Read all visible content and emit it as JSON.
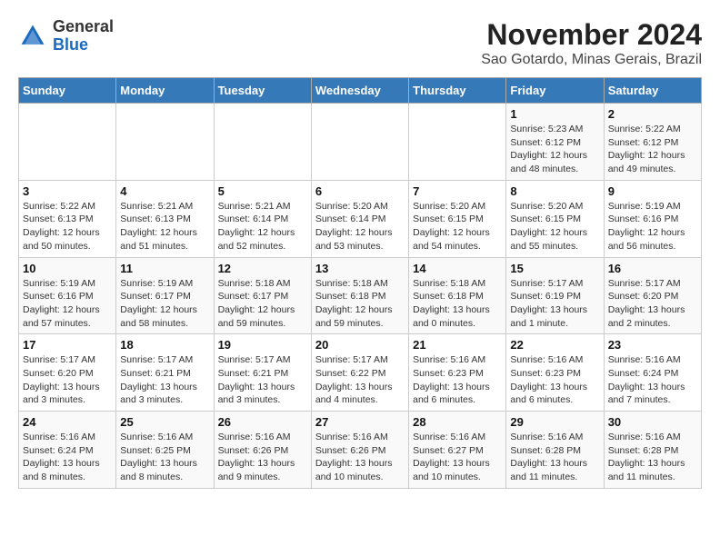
{
  "logo": {
    "general": "General",
    "blue": "Blue"
  },
  "title": "November 2024",
  "subtitle": "Sao Gotardo, Minas Gerais, Brazil",
  "headers": [
    "Sunday",
    "Monday",
    "Tuesday",
    "Wednesday",
    "Thursday",
    "Friday",
    "Saturday"
  ],
  "weeks": [
    [
      {
        "day": "",
        "info": ""
      },
      {
        "day": "",
        "info": ""
      },
      {
        "day": "",
        "info": ""
      },
      {
        "day": "",
        "info": ""
      },
      {
        "day": "",
        "info": ""
      },
      {
        "day": "1",
        "info": "Sunrise: 5:23 AM\nSunset: 6:12 PM\nDaylight: 12 hours and 48 minutes."
      },
      {
        "day": "2",
        "info": "Sunrise: 5:22 AM\nSunset: 6:12 PM\nDaylight: 12 hours and 49 minutes."
      }
    ],
    [
      {
        "day": "3",
        "info": "Sunrise: 5:22 AM\nSunset: 6:13 PM\nDaylight: 12 hours and 50 minutes."
      },
      {
        "day": "4",
        "info": "Sunrise: 5:21 AM\nSunset: 6:13 PM\nDaylight: 12 hours and 51 minutes."
      },
      {
        "day": "5",
        "info": "Sunrise: 5:21 AM\nSunset: 6:14 PM\nDaylight: 12 hours and 52 minutes."
      },
      {
        "day": "6",
        "info": "Sunrise: 5:20 AM\nSunset: 6:14 PM\nDaylight: 12 hours and 53 minutes."
      },
      {
        "day": "7",
        "info": "Sunrise: 5:20 AM\nSunset: 6:15 PM\nDaylight: 12 hours and 54 minutes."
      },
      {
        "day": "8",
        "info": "Sunrise: 5:20 AM\nSunset: 6:15 PM\nDaylight: 12 hours and 55 minutes."
      },
      {
        "day": "9",
        "info": "Sunrise: 5:19 AM\nSunset: 6:16 PM\nDaylight: 12 hours and 56 minutes."
      }
    ],
    [
      {
        "day": "10",
        "info": "Sunrise: 5:19 AM\nSunset: 6:16 PM\nDaylight: 12 hours and 57 minutes."
      },
      {
        "day": "11",
        "info": "Sunrise: 5:19 AM\nSunset: 6:17 PM\nDaylight: 12 hours and 58 minutes."
      },
      {
        "day": "12",
        "info": "Sunrise: 5:18 AM\nSunset: 6:17 PM\nDaylight: 12 hours and 59 minutes."
      },
      {
        "day": "13",
        "info": "Sunrise: 5:18 AM\nSunset: 6:18 PM\nDaylight: 12 hours and 59 minutes."
      },
      {
        "day": "14",
        "info": "Sunrise: 5:18 AM\nSunset: 6:18 PM\nDaylight: 13 hours and 0 minutes."
      },
      {
        "day": "15",
        "info": "Sunrise: 5:17 AM\nSunset: 6:19 PM\nDaylight: 13 hours and 1 minute."
      },
      {
        "day": "16",
        "info": "Sunrise: 5:17 AM\nSunset: 6:20 PM\nDaylight: 13 hours and 2 minutes."
      }
    ],
    [
      {
        "day": "17",
        "info": "Sunrise: 5:17 AM\nSunset: 6:20 PM\nDaylight: 13 hours and 3 minutes."
      },
      {
        "day": "18",
        "info": "Sunrise: 5:17 AM\nSunset: 6:21 PM\nDaylight: 13 hours and 3 minutes."
      },
      {
        "day": "19",
        "info": "Sunrise: 5:17 AM\nSunset: 6:21 PM\nDaylight: 13 hours and 3 minutes."
      },
      {
        "day": "20",
        "info": "Sunrise: 5:17 AM\nSunset: 6:22 PM\nDaylight: 13 hours and 4 minutes."
      },
      {
        "day": "21",
        "info": "Sunrise: 5:16 AM\nSunset: 6:23 PM\nDaylight: 13 hours and 6 minutes."
      },
      {
        "day": "22",
        "info": "Sunrise: 5:16 AM\nSunset: 6:23 PM\nDaylight: 13 hours and 6 minutes."
      },
      {
        "day": "23",
        "info": "Sunrise: 5:16 AM\nSunset: 6:24 PM\nDaylight: 13 hours and 7 minutes."
      }
    ],
    [
      {
        "day": "24",
        "info": "Sunrise: 5:16 AM\nSunset: 6:24 PM\nDaylight: 13 hours and 8 minutes."
      },
      {
        "day": "25",
        "info": "Sunrise: 5:16 AM\nSunset: 6:25 PM\nDaylight: 13 hours and 8 minutes."
      },
      {
        "day": "26",
        "info": "Sunrise: 5:16 AM\nSunset: 6:26 PM\nDaylight: 13 hours and 9 minutes."
      },
      {
        "day": "27",
        "info": "Sunrise: 5:16 AM\nSunset: 6:26 PM\nDaylight: 13 hours and 10 minutes."
      },
      {
        "day": "28",
        "info": "Sunrise: 5:16 AM\nSunset: 6:27 PM\nDaylight: 13 hours and 10 minutes."
      },
      {
        "day": "29",
        "info": "Sunrise: 5:16 AM\nSunset: 6:28 PM\nDaylight: 13 hours and 11 minutes."
      },
      {
        "day": "30",
        "info": "Sunrise: 5:16 AM\nSunset: 6:28 PM\nDaylight: 13 hours and 11 minutes."
      }
    ]
  ]
}
